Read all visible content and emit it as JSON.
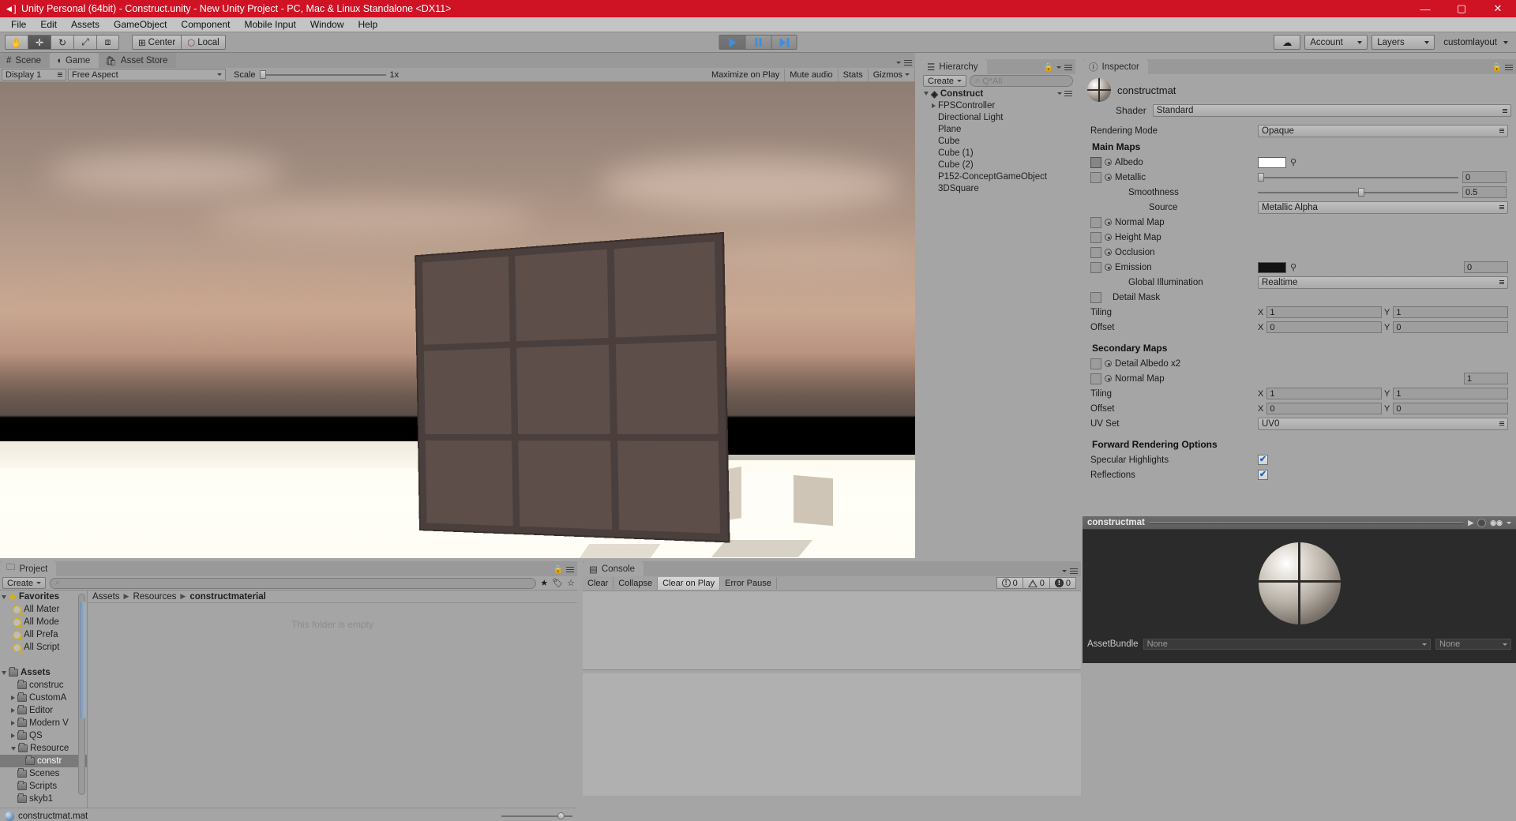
{
  "window": {
    "title": "Unity Personal (64bit) - Construct.unity - New Unity Project - PC, Mac & Linux Standalone <DX11>",
    "app_icon": "unity-icon",
    "minimize": "—",
    "maximize": "▢",
    "close": "✕"
  },
  "menubar": {
    "items": [
      "File",
      "Edit",
      "Assets",
      "GameObject",
      "Component",
      "Mobile Input",
      "Window",
      "Help"
    ]
  },
  "toolbar": {
    "transform_tools": [
      {
        "name": "hand-tool",
        "glyph": "✋",
        "active": false
      },
      {
        "name": "move-tool",
        "glyph": "✛",
        "active": true
      },
      {
        "name": "rotate-tool",
        "glyph": "↻",
        "active": false
      },
      {
        "name": "scale-tool",
        "glyph": "⤢",
        "active": false
      },
      {
        "name": "rect-tool",
        "glyph": "⧈",
        "active": false
      }
    ],
    "pivot_label": "Center",
    "space_label": "Local",
    "play": "play",
    "pause": "pause",
    "step": "step",
    "cloud_label": "cloud",
    "account_label": "Account",
    "layers_label": "Layers",
    "layout_label": "customlayout"
  },
  "game_panel": {
    "tabs": [
      {
        "label": "Scene",
        "icon": "grid-icon",
        "active": false
      },
      {
        "label": "Game",
        "icon": "gamepad-icon",
        "active": true
      },
      {
        "label": "Asset Store",
        "icon": "store-icon",
        "active": false
      }
    ],
    "display": "Display 1",
    "aspect": "Free Aspect",
    "scale_label": "Scale",
    "scale_value": "1x",
    "maximize_on_play": "Maximize on Play",
    "mute_audio": "Mute audio",
    "stats": "Stats",
    "gizmos": "Gizmos"
  },
  "hierarchy": {
    "tab_label": "Hierarchy",
    "create_label": "Create",
    "search_placeholder": "Q*All",
    "root": "Construct",
    "items": [
      {
        "label": "FPSController",
        "expandable": true
      },
      {
        "label": "Directional Light",
        "expandable": false
      },
      {
        "label": "Plane",
        "expandable": false
      },
      {
        "label": "Cube",
        "expandable": false
      },
      {
        "label": "Cube (1)",
        "expandable": false
      },
      {
        "label": "Cube (2)",
        "expandable": false
      },
      {
        "label": "P152-ConceptGameObject",
        "expandable": false
      },
      {
        "label": "3DSquare",
        "expandable": false
      }
    ]
  },
  "inspector": {
    "tab_label": "Inspector",
    "material_name": "constructmat",
    "shader_label": "Shader",
    "shader_value": "Standard",
    "rendering_mode_label": "Rendering Mode",
    "rendering_mode_value": "Opaque",
    "main_maps_label": "Main Maps",
    "albedo_label": "Albedo",
    "albedo_color": "#ffffff",
    "metallic_label": "Metallic",
    "metallic_value": "0",
    "smoothness_label": "Smoothness",
    "smoothness_value": "0.5",
    "source_label": "Source",
    "source_value": "Metallic Alpha",
    "normal_map_label": "Normal Map",
    "height_map_label": "Height Map",
    "occlusion_label": "Occlusion",
    "emission_label": "Emission",
    "emission_color": "#121212",
    "emission_value": "0",
    "global_illumination_label": "Global Illumination",
    "global_illumination_value": "Realtime",
    "detail_mask_label": "Detail Mask",
    "tiling_label": "Tiling",
    "offset_label": "Offset",
    "tiling_x_axis": "X",
    "tiling_x": "1",
    "tiling_y_axis": "Y",
    "tiling_y": "1",
    "offset_x_axis": "X",
    "offset_x": "0",
    "offset_y_axis": "Y",
    "offset_y": "0",
    "secondary_maps_label": "Secondary Maps",
    "detail_albedo_label": "Detail Albedo x2",
    "secondary_normal_label": "Normal Map",
    "secondary_normal_value": "1",
    "sec_tiling_label": "Tiling",
    "sec_offset_label": "Offset",
    "sec_tiling_x_axis": "X",
    "sec_tiling_x": "1",
    "sec_tiling_y_axis": "Y",
    "sec_tiling_y": "1",
    "sec_offset_x_axis": "X",
    "sec_offset_x": "0",
    "sec_offset_y_axis": "Y",
    "sec_offset_y": "0",
    "uv_set_label": "UV Set",
    "uv_set_value": "UV0",
    "forward_rendering_label": "Forward Rendering Options",
    "specular_highlights_label": "Specular Highlights",
    "reflections_label": "Reflections",
    "checkmark": "✔",
    "preview_title": "constructmat",
    "asset_bundle_label": "AssetBundle",
    "asset_bundle_value": "None",
    "asset_bundle_variant": "None"
  },
  "project": {
    "tab_label": "Project",
    "create_label": "Create",
    "search_placeholder": "",
    "favorites_label": "Favorites",
    "favorites": [
      "All Mater",
      "All Mode",
      "All Prefa",
      "All Script"
    ],
    "assets_label": "Assets",
    "tree": [
      {
        "label": "construc",
        "indent": 1,
        "expandable": false,
        "selected": false
      },
      {
        "label": "CustomA",
        "indent": 1,
        "expandable": true,
        "selected": false
      },
      {
        "label": "Editor",
        "indent": 1,
        "expandable": true,
        "selected": false
      },
      {
        "label": "Modern V",
        "indent": 1,
        "expandable": true,
        "selected": false
      },
      {
        "label": "QS",
        "indent": 1,
        "expandable": true,
        "selected": false
      },
      {
        "label": "Resource",
        "indent": 1,
        "expandable": true,
        "expanded": true,
        "selected": false
      },
      {
        "label": "constr",
        "indent": 2,
        "expandable": false,
        "selected": true
      },
      {
        "label": "Scenes",
        "indent": 1,
        "expandable": false,
        "selected": false
      },
      {
        "label": "Scripts",
        "indent": 1,
        "expandable": false,
        "selected": false
      },
      {
        "label": "skyb1",
        "indent": 1,
        "expandable": false,
        "selected": false
      }
    ],
    "breadcrumb": [
      "Assets",
      "Resources",
      "constructmaterial"
    ],
    "empty_message": "This folder is empty",
    "footer_file": "constructmat.mat"
  },
  "console": {
    "tab_label": "Console",
    "clear_label": "Clear",
    "collapse_label": "Collapse",
    "clear_on_play_label": "Clear on Play",
    "error_pause_label": "Error Pause",
    "log_count": "0",
    "warning_count": "0",
    "error_count": "0"
  }
}
